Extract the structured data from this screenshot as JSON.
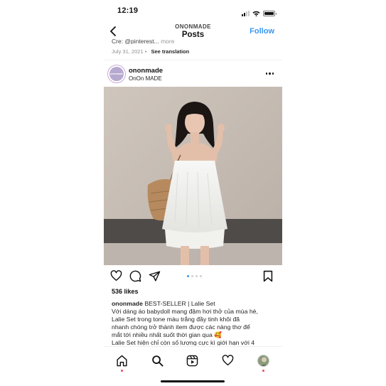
{
  "status_bar": {
    "time": "12:19"
  },
  "header": {
    "subtitle": "ONONMADE",
    "title": "Posts",
    "follow_label": "Follow"
  },
  "previous_post": {
    "caption_text": "Cre: @pinterest...",
    "more_label": " more",
    "date": "July 31, 2021",
    "translate_label": "See translation"
  },
  "post": {
    "avatar_text": "ononmade",
    "username": "ononmade",
    "location": "OnOn MADE",
    "likes": "536 likes",
    "carousel": {
      "count": 4,
      "active_index": 0
    },
    "caption": {
      "username": "ononmade",
      "title": "BEST-SELLER | Lalie Set",
      "lines": [
        "Với dáng áo babydoll mang đậm hơi thở của mùa hè,",
        "Lalie Set trong tone màu trắng đầy tinh khôi đã",
        "nhanh chóng trở thành item được các nàng thơ để",
        "mắt tới nhiều nhất suốt thời gian qua 🥰",
        "Lalie Set hiện chỉ còn số lượng cực kì giới hạn với 4"
      ]
    }
  },
  "icons": {
    "back": "chevron-left-icon",
    "more": "more-horizontal-icon",
    "like": "heart-icon",
    "comment": "comment-icon",
    "share": "send-icon",
    "save": "bookmark-icon"
  },
  "tab_bar": {
    "items": [
      "home",
      "search",
      "reels",
      "activity",
      "profile"
    ]
  },
  "colors": {
    "accent": "#3897f0",
    "notification_dot": "#ed4956"
  }
}
